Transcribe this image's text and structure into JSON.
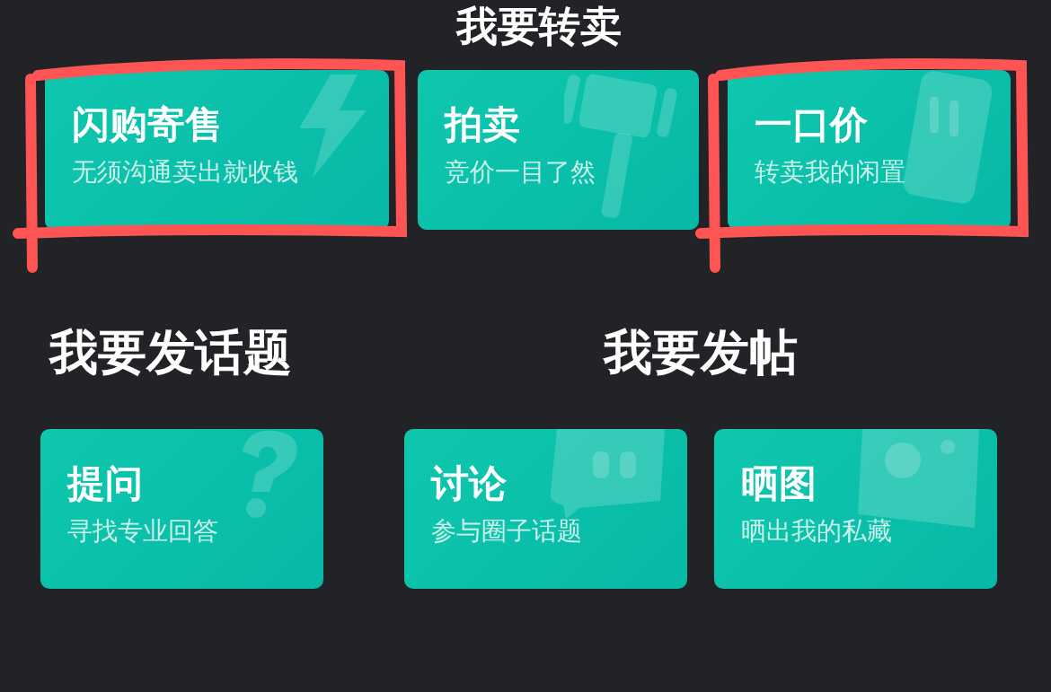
{
  "resale": {
    "title": "我要转卖",
    "cards": [
      {
        "title": "闪购寄售",
        "subtitle": "无须沟通卖出就收钱",
        "highlighted": true
      },
      {
        "title": "拍卖",
        "subtitle": "竞价一目了然",
        "highlighted": false
      },
      {
        "title": "一口价",
        "subtitle": "转卖我的闲置",
        "highlighted": true
      }
    ]
  },
  "topic": {
    "title": "我要发话题",
    "cards": [
      {
        "title": "提问",
        "subtitle": "寻找专业回答"
      }
    ]
  },
  "post": {
    "title": "我要发帖",
    "cards": [
      {
        "title": "讨论",
        "subtitle": "参与圈子话题"
      },
      {
        "title": "晒图",
        "subtitle": "晒出我的私藏"
      }
    ]
  }
}
